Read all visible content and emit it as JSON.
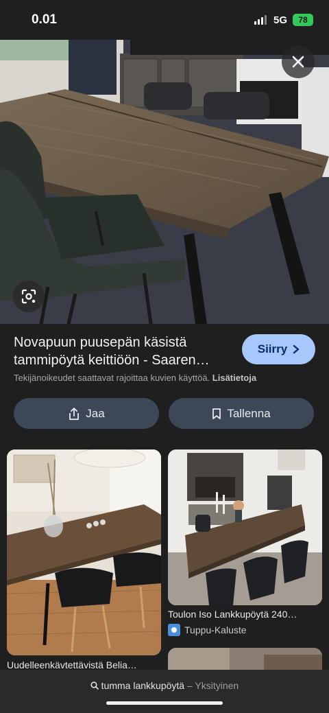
{
  "status_bar": {
    "time": "0.01",
    "network": "5G",
    "battery": "78"
  },
  "image_result": {
    "title": "Novapuun puusepän käsistä tammipöytä keittiöön - Saaren…",
    "visit_button": "Siirry",
    "copyright_text": "Tekijänoikeudet saattavat rajoittaa kuvien käyttöä.",
    "more_info_link": "Lisätietoja"
  },
  "actions": {
    "share_label": "Jaa",
    "save_label": "Tallenna"
  },
  "related": [
    {
      "title": "Uudelleenkävtettävistä Belia…",
      "source": ""
    },
    {
      "title": "Toulon Iso Lankkupöytä 240…",
      "source": "Tuppu-Kaluste"
    }
  ],
  "search_bar": {
    "query": "tumma lankkupöytä",
    "mode": "Yksityinen"
  },
  "icons": [
    "close-icon",
    "lens-icon",
    "share-icon",
    "bookmark-icon",
    "chevron-right-icon",
    "search-icon"
  ]
}
